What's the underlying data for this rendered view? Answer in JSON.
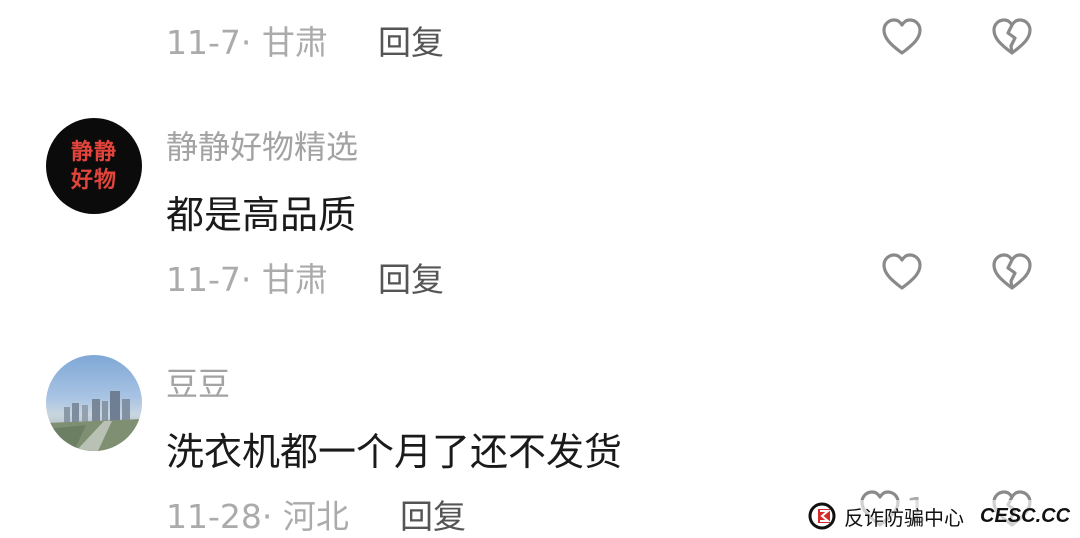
{
  "comments": [
    {
      "meta": "11-7· 甘肃",
      "reply_label": "回复"
    },
    {
      "avatar_lines": [
        "静静",
        "好物"
      ],
      "username": "静静好物精选",
      "text": "都是高品质",
      "meta": "11-7· 甘肃",
      "reply_label": "回复"
    },
    {
      "username": "豆豆",
      "text": "洗衣机都一个月了还不发货",
      "meta": "11-28· 河北",
      "reply_label": "回复",
      "like_count": "1"
    }
  ],
  "icons": {
    "like": "heart-outline-icon",
    "dislike": "broken-heart-icon"
  },
  "watermark": {
    "text": "反诈防骗中心",
    "brand": "CESC.CC"
  },
  "colors": {
    "meta_gray": "#ababab",
    "username_gray": "#a3a3a3",
    "text_dark": "#1a1a1a",
    "icon_gray": "#8a8a8a",
    "seal_red": "#e2443c"
  }
}
